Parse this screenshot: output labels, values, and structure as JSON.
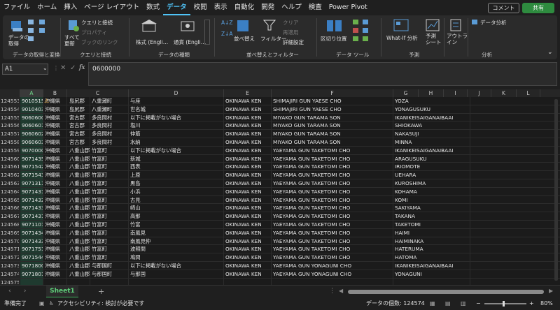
{
  "menubar": {
    "tabs": [
      "ファイル",
      "ホーム",
      "挿入",
      "ページ レイアウト",
      "数式",
      "データ",
      "校閲",
      "表示",
      "自動化",
      "開発",
      "ヘルプ",
      "検査",
      "Power Pivot"
    ],
    "active": "データ",
    "comment": "コメント",
    "share": "共有"
  },
  "ribbon": {
    "get_data": "データの\n取得",
    "get_group": "データの取得と変換",
    "refresh_all": "すべて\n更新",
    "queries": "クエリと接続",
    "properties": "プロパティ",
    "links": "ブックのリンク",
    "query_group": "クエリと接続",
    "stocks": "株式 (Engli…",
    "currency": "通貨 (Engli…",
    "types_group": "データの種類",
    "sort": "並べ替え",
    "filter": "フィルター",
    "clear": "クリア",
    "reapply": "再適用",
    "advanced": "詳細設定",
    "sort_group": "並べ替えとフィルター",
    "text_to_cols": "区切り位置",
    "tools_group": "データ ツール",
    "whatif": "What-If 分析",
    "forecast": "予測\nシート",
    "forecast_group": "予測",
    "outline": "アウトラ\nイン",
    "analysis": "データ分析",
    "analysis_group": "分析"
  },
  "formula": {
    "cell": "A1",
    "content": "0600000"
  },
  "columns": [
    "A",
    "B",
    "C",
    "D",
    "E",
    "F",
    "G",
    "H",
    "I",
    "J",
    "K",
    "L"
  ],
  "rows": [
    [
      "124553",
      "9010515",
      "沖縄県",
      "島尻郡",
      "八重瀬町",
      "与座",
      "OKINAWA KEN",
      "SHIMAJIRI GUN YAESE CHO",
      "YOZA"
    ],
    [
      "124554",
      "9010403",
      "沖縄県",
      "島尻郡",
      "八重瀬町",
      "世名城",
      "OKINAWA KEN",
      "SHIMAJIRI GUN YAESE CHO",
      "YONAGUSUKU"
    ],
    [
      "124555",
      "9060600",
      "沖縄県",
      "宮古郡",
      "多良間村",
      "以下に掲載がない場合",
      "OKINAWA KEN",
      "MIYAKO GUN TARAMA SON",
      "IKANIKEISAIGANAIBAAI"
    ],
    [
      "124556",
      "9060601",
      "沖縄県",
      "宮古郡",
      "多良間村",
      "塩川",
      "OKINAWA KEN",
      "MIYAKO GUN TARAMA SON",
      "SHIOKAWA"
    ],
    [
      "124557",
      "9060602",
      "沖縄県",
      "宮古郡",
      "多良間村",
      "仲筋",
      "OKINAWA KEN",
      "MIYAKO GUN TARAMA SON",
      "NAKASUJI"
    ],
    [
      "124558",
      "9060603",
      "沖縄県",
      "宮古郡",
      "多良間村",
      "水納",
      "OKINAWA KEN",
      "MIYAKO GUN TARAMA SON",
      "MINNA"
    ],
    [
      "124559",
      "9070000",
      "沖縄県",
      "八重山郡",
      "竹富町",
      "以下に掲載がない場合",
      "OKINAWA KEN",
      "YAEYAMA GUN TAKETOMI CHO",
      "IKANIKEISAIGANAIBAAI"
    ],
    [
      "124560",
      "9071435",
      "沖縄県",
      "八重山郡",
      "竹富町",
      "新城",
      "OKINAWA KEN",
      "YAEYAMA GUN TAKETOMI CHO",
      "ARAGUSUKU"
    ],
    [
      "124561",
      "9071542",
      "沖縄県",
      "八重山郡",
      "竹富町",
      "西表",
      "OKINAWA KEN",
      "YAEYAMA GUN TAKETOMI CHO",
      "IRIOMOTE"
    ],
    [
      "124562",
      "9071543",
      "沖縄県",
      "八重山郡",
      "竹富町",
      "上原",
      "OKINAWA KEN",
      "YAEYAMA GUN TAKETOMI CHO",
      "UEHARA"
    ],
    [
      "124563",
      "9071311",
      "沖縄県",
      "八重山郡",
      "竹富町",
      "黒島",
      "OKINAWA KEN",
      "YAEYAMA GUN TAKETOMI CHO",
      "KUROSHIMA"
    ],
    [
      "124564",
      "9071431",
      "沖縄県",
      "八重山郡",
      "竹富町",
      "小浜",
      "OKINAWA KEN",
      "YAEYAMA GUN TAKETOMI CHO",
      "KOHAMA"
    ],
    [
      "124565",
      "9071432",
      "沖縄県",
      "八重山郡",
      "竹富町",
      "古見",
      "OKINAWA KEN",
      "YAEYAMA GUN TAKETOMI CHO",
      "KOMI"
    ],
    [
      "124566",
      "9071433",
      "沖縄県",
      "八重山郡",
      "竹富町",
      "崎山",
      "OKINAWA KEN",
      "YAEYAMA GUN TAKETOMI CHO",
      "SAKIYAMA"
    ],
    [
      "124567",
      "9071431",
      "沖縄県",
      "八重山郡",
      "竹富町",
      "高那",
      "OKINAWA KEN",
      "YAEYAMA GUN TAKETOMI CHO",
      "TAKANA"
    ],
    [
      "124568",
      "9071101",
      "沖縄県",
      "八重山郡",
      "竹富町",
      "竹富",
      "OKINAWA KEN",
      "YAEYAMA GUN TAKETOMI CHO",
      "TAKETOMI"
    ],
    [
      "124569",
      "9071434",
      "沖縄県",
      "八重山郡",
      "竹富町",
      "南風見",
      "OKINAWA KEN",
      "YAEYAMA GUN TAKETOMI CHO",
      "HAIMI"
    ],
    [
      "124570",
      "9071433",
      "沖縄県",
      "八重山郡",
      "竹富町",
      "南風見仲",
      "OKINAWA KEN",
      "YAEYAMA GUN TAKETOMI CHO",
      "HAIMINAKA"
    ],
    [
      "124571",
      "9071751",
      "沖縄県",
      "八重山郡",
      "竹富町",
      "波照間",
      "OKINAWA KEN",
      "YAEYAMA GUN TAKETOMI CHO",
      "HATERUMA"
    ],
    [
      "124572",
      "9071544",
      "沖縄県",
      "八重山郡",
      "竹富町",
      "鳩間",
      "OKINAWA KEN",
      "YAEYAMA GUN TAKETOMI CHO",
      "HATOMA"
    ],
    [
      "124573",
      "9071800",
      "沖縄県",
      "八重山郡",
      "与那国町",
      "以下に掲載がない場合",
      "OKINAWA KEN",
      "YAEYAMA GUN YONAGUNI CHO",
      "IKANIKEISAIGANAIBAAI"
    ],
    [
      "124574",
      "9071801",
      "沖縄県",
      "八重山郡",
      "与那国町",
      "与那国",
      "OKINAWA KEN",
      "YAEYAMA GUN YONAGUNI CHO",
      "YONAGUNI"
    ],
    [
      "124575",
      "",
      "",
      "",
      "",
      "",
      "",
      "",
      ""
    ]
  ],
  "sheet_tab": "Sheet1",
  "status": {
    "ready": "準備完了",
    "accessibility": "アクセシビリティ: 検討が必要です",
    "count": "データの個数: 124574",
    "zoom": "80%"
  }
}
